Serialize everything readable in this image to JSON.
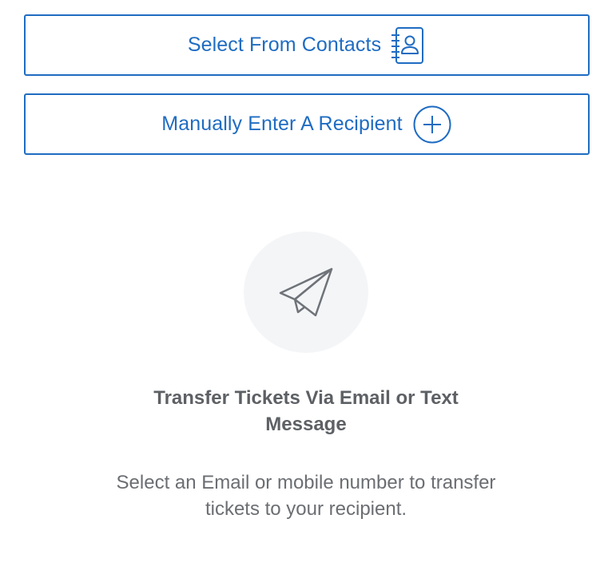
{
  "actions": {
    "select_contacts_label": "Select From Contacts",
    "manual_entry_label": "Manually Enter A Recipient"
  },
  "icons": {
    "contacts": "contacts-book-icon",
    "add": "plus-circle-icon",
    "empty_state": "paper-plane-icon"
  },
  "empty_state": {
    "title": "Transfer Tickets Via Email or Text Message",
    "description": "Select an Email or mobile number to transfer tickets to your recipient."
  },
  "colors": {
    "accent": "#1f6cc2",
    "title_text": "#5d6064",
    "body_text": "#6b6e72",
    "icon_circle_bg": "#f4f5f7",
    "icon_stroke": "#6f7379"
  }
}
